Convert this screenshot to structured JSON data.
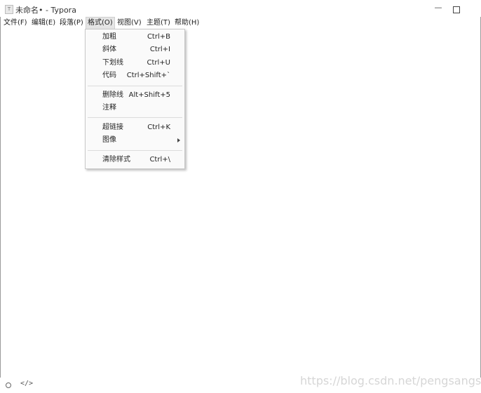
{
  "window": {
    "title": "未命名• - Typora",
    "app_icon_letter": "T",
    "minimize_glyph": "—"
  },
  "menubar": {
    "items": [
      {
        "label": "文件(F)"
      },
      {
        "label": "编辑(E)"
      },
      {
        "label": "段落(P)"
      },
      {
        "label": "格式(O)",
        "active": true
      },
      {
        "label": "视图(V)"
      },
      {
        "label": "主题(T)"
      },
      {
        "label": "帮助(H)"
      }
    ]
  },
  "format_menu": {
    "items": [
      {
        "label": "加粗",
        "shortcut": "Ctrl+B"
      },
      {
        "label": "斜体",
        "shortcut": "Ctrl+I"
      },
      {
        "label": "下划线",
        "shortcut": "Ctrl+U"
      },
      {
        "label": "代码",
        "shortcut": "Ctrl+Shift+`"
      },
      {
        "label": "删除线",
        "shortcut": "Alt+Shift+5"
      },
      {
        "label": "注释",
        "shortcut": ""
      },
      {
        "label": "超链接",
        "shortcut": "Ctrl+K"
      },
      {
        "label": "图像",
        "shortcut": "",
        "submenu": true
      },
      {
        "label": "清除样式",
        "shortcut": "Ctrl+\\"
      }
    ]
  },
  "statusbar": {
    "source_toggle_glyph": "</>"
  },
  "watermark": "https://blog.csdn.net/pengsangsang",
  "icons": {
    "app": "typora-app-icon",
    "minimize": "minimize-icon",
    "maximize": "maximize-icon",
    "outline": "circle-icon",
    "source": "code-icon",
    "submenu": "chevron-right-icon"
  },
  "colors": {
    "menu_bg": "#fafafa",
    "menu_active_bg": "#e5e5e5",
    "separator": "#dcdcdc"
  }
}
